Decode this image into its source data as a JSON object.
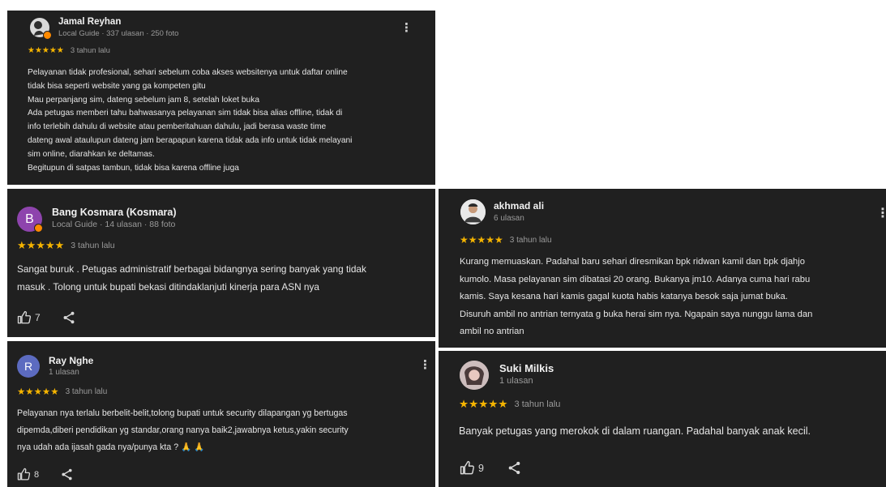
{
  "reviews": [
    {
      "name": "Jamal Reyhan",
      "meta": "Local Guide · 337 ulasan · 250 foto",
      "stars": "★★★★★",
      "time": "3 tahun lalu",
      "lines": [
        "Pelayanan tidak profesional, sehari sebelum coba akses websitenya untuk daftar online",
        "tidak bisa seperti website yang ga kompeten gitu",
        "Mau perpanjang sim, dateng sebelum jam 8, setelah loket buka",
        "Ada petugas memberi tahu bahwasanya pelayanan sim tidak bisa alias offline, tidak di",
        "info terlebih dahulu di website atau pemberitahuan dahulu, jadi berasa waste time",
        "dateng awal ataulupun dateng jam berapapun karena tidak ada info untuk tidak melayani",
        "sim online, diarahkan ke deltamas.",
        "Begitupun di satpas tambun, tidak bisa karena offline juga"
      ],
      "menu": "⋮"
    },
    {
      "name": "Bang Kosmara (Kosmara)",
      "meta": "Local Guide · 14 ulasan · 88 foto",
      "avatar_letter": "B",
      "stars": "★★★★★",
      "time": "3 tahun lalu",
      "lines": [
        "Sangat buruk . Petugas administratif berbagai bidangnya sering banyak yang tidak",
        "masuk . Tolong untuk bupati bekasi ditindaklanjuti kinerja para ASN nya"
      ],
      "likes": "7"
    },
    {
      "name": "Ray Nghe",
      "meta": "1 ulasan",
      "avatar_letter": "R",
      "stars": "★★★★★",
      "time": "3 tahun lalu",
      "lines": [
        "Pelayanan nya terlalu berbelit-belit,tolong bupati untuk security dilapangan yg bertugas",
        "dipemda,diberi pendidikan yg standar,orang nanya baik2,jawabnya ketus,yakin security",
        "nya udah ada ijasah gada nya/punya kta ? 🙏 🙏"
      ],
      "likes": "8",
      "menu": "⋮"
    },
    {
      "name": "akhmad ali",
      "meta": "6 ulasan",
      "stars": "★★★★★",
      "time": "3 tahun lalu",
      "lines": [
        "Kurang memuaskan. Padahal baru sehari diresmikan bpk ridwan kamil dan bpk djahjo",
        "kumolo. Masa pelayanan sim dibatasi 20 orang. Bukanya jm10. Adanya cuma hari rabu",
        "kamis. Saya kesana hari kamis gagal kuota habis katanya besok saja jumat buka.",
        "Disuruh ambil no antrian ternyata g buka herai sim nya. Ngapain saya nunggu lama dan",
        "ambil no antrian"
      ],
      "menu": "⋮"
    },
    {
      "name": "Suki Milkis",
      "meta": "1 ulasan",
      "stars": "★★★★★",
      "time": "3 tahun lalu",
      "lines": [
        "Banyak petugas yang merokok di dalam ruangan. Padahal banyak anak kecil."
      ],
      "likes": "9"
    }
  ],
  "colors": {
    "card_bg": "#202020",
    "star": "#f5b400",
    "avatar_b": "#8e44ad",
    "avatar_r": "#5c6bc0"
  },
  "icons": [
    "thumbs-up-icon",
    "share-icon",
    "more-vert-icon",
    "local-guide-badge-icon"
  ]
}
